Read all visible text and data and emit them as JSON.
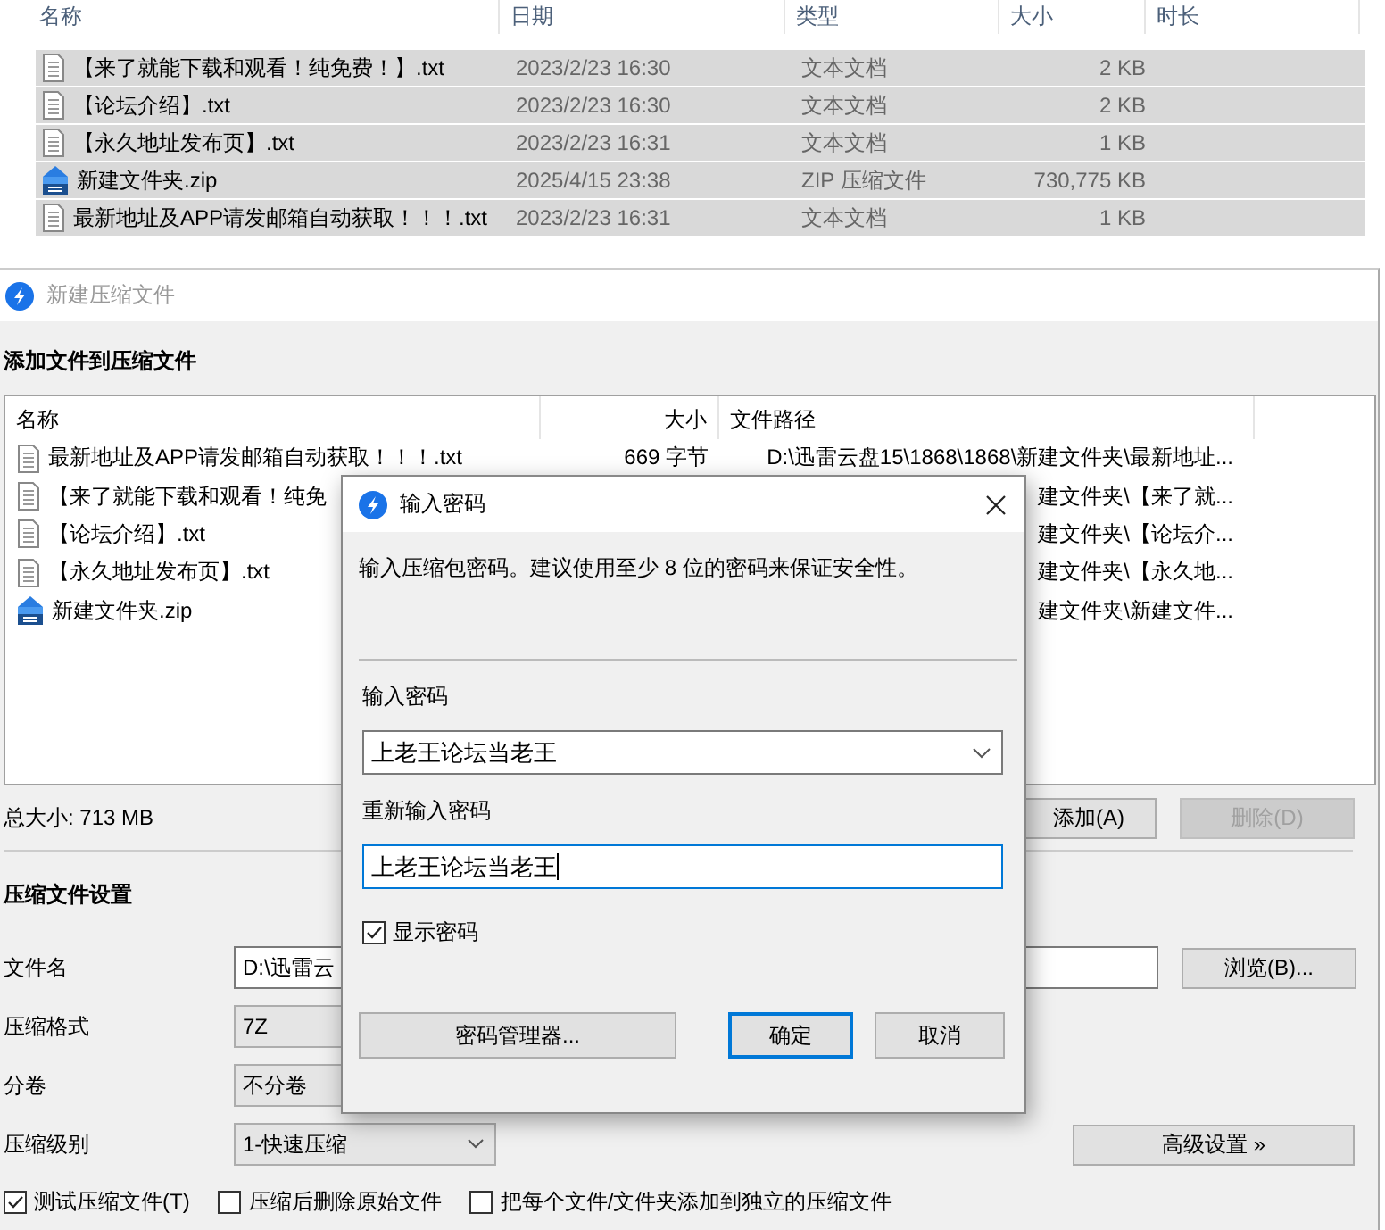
{
  "explorer": {
    "columns": [
      "名称",
      "日期",
      "类型",
      "大小",
      "时长"
    ],
    "rows": [
      {
        "kind": "txt",
        "name": "【来了就能下载和观看！纯免费！】.txt",
        "date": "2023/2/23 16:30",
        "type": "文本文档",
        "size": "2 KB",
        "selected": true
      },
      {
        "kind": "txt",
        "name": "【论坛介绍】.txt",
        "date": "2023/2/23 16:30",
        "type": "文本文档",
        "size": "2 KB",
        "selected": true
      },
      {
        "kind": "txt",
        "name": "【永久地址发布页】.txt",
        "date": "2023/2/23 16:31",
        "type": "文本文档",
        "size": "1 KB",
        "selected": true
      },
      {
        "kind": "zip",
        "name": "新建文件夹.zip",
        "date": "2025/4/15 23:38",
        "type": "ZIP 压缩文件",
        "size": "730,775 KB",
        "selected": true
      },
      {
        "kind": "txt",
        "name": "最新地址及APP请发邮箱自动获取！！！.txt",
        "date": "2023/2/23 16:31",
        "type": "文本文档",
        "size": "1 KB",
        "selected": true
      }
    ]
  },
  "compress_window": {
    "title": "新建压缩文件",
    "section_title": "添加文件到压缩文件",
    "file_list": {
      "columns": [
        "名称",
        "大小",
        "文件路径"
      ],
      "rows": [
        {
          "kind": "txt",
          "name": "最新地址及APP请发邮箱自动获取！！！.txt",
          "size": "669 字节",
          "path": "D:\\迅雷云盘15\\1868\\1868\\新建文件夹\\最新地址..."
        },
        {
          "kind": "txt",
          "name": "【来了就能下载和观看！纯免",
          "path": "建文件夹\\【来了就..."
        },
        {
          "kind": "txt",
          "name": "【论坛介绍】.txt",
          "path": "建文件夹\\【论坛介..."
        },
        {
          "kind": "txt",
          "name": "【永久地址发布页】.txt",
          "path": "建文件夹\\【永久地..."
        },
        {
          "kind": "zip",
          "name": "新建文件夹.zip",
          "path": "建文件夹\\新建文件..."
        }
      ]
    },
    "total_size": "总大小: 713 MB",
    "add_button": {
      "label": "添加(A)",
      "disabled": false
    },
    "delete_button": {
      "label": "删除(D)",
      "disabled": true
    },
    "settings_title": "压缩文件设置",
    "settings": [
      {
        "kind": "text",
        "label": "文件名",
        "value": "D:\\迅雷云"
      },
      {
        "kind": "readonly",
        "label": "压缩格式",
        "value": "7Z"
      },
      {
        "kind": "readonly",
        "label": "分卷",
        "value": "不分卷"
      },
      {
        "kind": "select",
        "label": "压缩级别",
        "value": "1-快速压缩"
      }
    ],
    "browse_button": "浏览(B)...",
    "advanced_button": "高级设置 »",
    "options": [
      {
        "label": "测试压缩文件(T)",
        "checked": true
      },
      {
        "label": "压缩后删除原始文件",
        "checked": false
      },
      {
        "label": "把每个文件/文件夹添加到独立的压缩文件",
        "checked": false
      }
    ]
  },
  "password_dialog": {
    "title": "输入密码",
    "message": "输入压缩包密码。建议使用至少 8 位的密码来保证安全性。",
    "password_label": "输入密码",
    "password": "上老王论坛当老王",
    "confirm_label": "重新输入密码",
    "confirm": "上老王论坛当老王",
    "show_password": {
      "label": "显示密码",
      "checked": true
    },
    "buttons": [
      {
        "label": "密码管理器...",
        "default": false
      },
      {
        "label": "确定",
        "default": true
      },
      {
        "label": "取消",
        "default": false
      }
    ]
  }
}
